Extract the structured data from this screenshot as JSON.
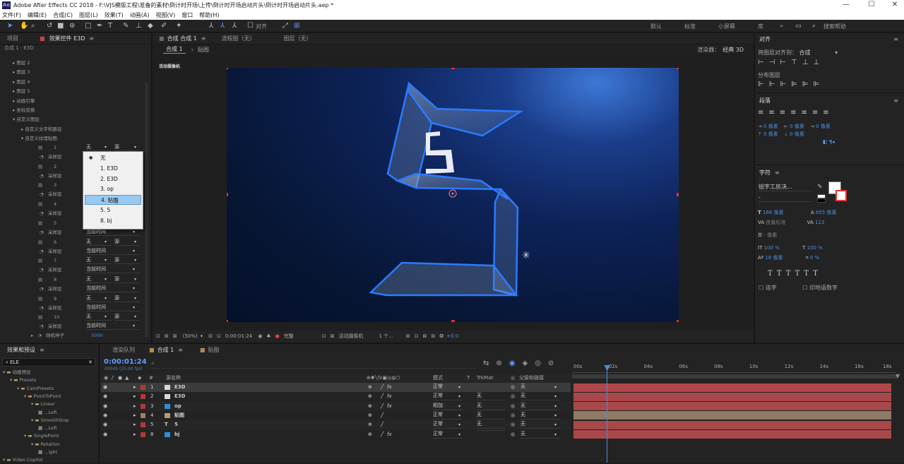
{
  "titlebar": {
    "logo": "Ae",
    "title": "Adobe After Effects CC 2018 - F:\\VJS模版工程\\准备的素材\\倒计时开场\\上传\\倒计时开场启动片头\\倒计时开场启动片头.aep *",
    "min": "—",
    "max": "☐",
    "close": "✕"
  },
  "menubar": [
    "文件(F)",
    "编辑(E)",
    "合成(C)",
    "图层(L)",
    "效果(T)",
    "动画(A)",
    "视图(V)",
    "窗口",
    "帮助(H)"
  ],
  "toolbar": {
    "align_label": "对齐",
    "workspaces": [
      "默认",
      "标准",
      "小屏幕",
      "库"
    ],
    "more": "»",
    "search_placeholder": "搜索帮助"
  },
  "left_panel": {
    "tab_project": "项目",
    "tab_effect_controls": "效果控件 E3D",
    "breadcrumb": "合成 1 · E3D",
    "tree": [
      {
        "label": "图层 2",
        "depth": 0
      },
      {
        "label": "图层 3",
        "depth": 0
      },
      {
        "label": "图层 4",
        "depth": 0
      },
      {
        "label": "图层 5",
        "depth": 0
      },
      {
        "label": "动画引擎",
        "depth": 0
      },
      {
        "label": "坐标变换",
        "depth": 0
      },
      {
        "label": "自定义图层",
        "depth": 0,
        "open": true
      },
      {
        "label": "自定义文字和路径",
        "depth": 1
      },
      {
        "label": "自定义纹理贴图",
        "depth": 1,
        "open": true
      }
    ],
    "texture_rows": [
      {
        "num": "1",
        "layer": "无",
        "src": "源",
        "sample_label": "采样层",
        "sample_value": ""
      },
      {
        "num": "2",
        "layer": "无",
        "src": "源",
        "sample_label": "采样层",
        "sample_value": ""
      },
      {
        "num": "3",
        "layer": "无",
        "src": "源",
        "sample_label": "采样层",
        "sample_value": ""
      },
      {
        "num": "4",
        "layer": "无",
        "src": "源",
        "sample_label": "采样层",
        "sample_value": ""
      },
      {
        "num": "5",
        "layer": "无",
        "src": "源",
        "sample_label": "采样层",
        "sample_value": "当前时间"
      },
      {
        "num": "6",
        "layer": "无",
        "src": "源",
        "sample_label": "采样层",
        "sample_value": "当前时间"
      },
      {
        "num": "7",
        "layer": "无",
        "src": "源",
        "sample_label": "采样层",
        "sample_value": "当前时间"
      },
      {
        "num": "8",
        "layer": "无",
        "src": "源",
        "sample_label": "采样层",
        "sample_value": "当前时间"
      },
      {
        "num": "9",
        "layer": "无",
        "src": "源",
        "sample_label": "采样层",
        "sample_value": "当前时间"
      },
      {
        "num": "10",
        "layer": "无",
        "src": "源",
        "sample_label": "采样层",
        "sample_value": "当前时间"
      }
    ],
    "random_seed_label": "随机种子",
    "random_seed_value": "5000",
    "dropdown": {
      "items": [
        "无",
        "1. E3D",
        "2. E3D",
        "3. op",
        "4. 贴图",
        "5. 5",
        "8. bj"
      ],
      "selected_index": 0,
      "hovered_index": 4
    }
  },
  "comp_panel": {
    "tab_comp": "合成 合成 1",
    "tab_flow": "流程图（无）",
    "tab_layer": "图层（无）",
    "sub_tabs": [
      "合成 1",
      "贴图"
    ],
    "renderer_label": "渲染器：",
    "renderer_value": "经典 3D",
    "camera_label": "活动摄像机",
    "viewer_digit": "5",
    "footer": {
      "zoom": "(50%)",
      "timecode": "0:00:01:24",
      "resolution": "完整",
      "camera": "活动摄像机",
      "views": "1 个...",
      "exposure": "+0.0"
    }
  },
  "right_panel": {
    "align": {
      "title": "对齐",
      "align_to_label": "将图层对齐到：",
      "align_to_value": "合成",
      "distribute_label": "分布图层"
    },
    "paragraph": {
      "title": "段落",
      "indent_values": [
        "0 像素",
        "0 像素",
        "0 像素",
        "0 像素",
        "0 像素"
      ]
    },
    "character": {
      "title": "字符",
      "font": "锐字工房决...",
      "font_style": "-",
      "size": "166 像素",
      "leading": "655 像素",
      "kerning": "度量标准",
      "tracking": "113",
      "stroke": "- 像素",
      "vscale": "100 %",
      "hscale": "100 %",
      "baseline": "18 像素",
      "tsume": "0 %",
      "ligatures_label": "连字",
      "hindi_label": "印地语数字"
    }
  },
  "effects_panel": {
    "title": "效果和预设",
    "search_value": "ELE",
    "tree": [
      {
        "label": "动画预设",
        "depth": 0
      },
      {
        "label": "Presets",
        "depth": 1
      },
      {
        "label": "CamPresets",
        "depth": 2
      },
      {
        "label": "PointToPoint",
        "depth": 3
      },
      {
        "label": "Linear",
        "depth": 4
      },
      {
        "label": "...Left",
        "depth": 5
      },
      {
        "label": "SmoothStop",
        "depth": 4
      },
      {
        "label": "...Left",
        "depth": 5
      },
      {
        "label": "SinglePoint",
        "depth": 3
      },
      {
        "label": "Rotation",
        "depth": 4
      },
      {
        "label": "...ight",
        "depth": 5
      },
      {
        "label": "Video Copilot",
        "depth": 0
      }
    ]
  },
  "timeline": {
    "tab_render": "渲染队列",
    "tab_comp": "合成 1",
    "tab_texture": "贴图",
    "timecode": "0:00:01:24",
    "frame_info": "00049 (25.00 fps)",
    "columns": {
      "num": "#",
      "name": "源名称",
      "mode": "模式",
      "t": "T",
      "trkmat": "TrkMat",
      "parent": "父级和链接"
    },
    "ruler": [
      "00s",
      "02s",
      "04s",
      "06s",
      "08s",
      "10s",
      "12s",
      "14s",
      "16s",
      "18s"
    ],
    "playhead_fraction": 0.105,
    "layers": [
      {
        "num": "1",
        "name": "E3D",
        "color": "#d8d8d8",
        "label": "#b2373a",
        "mode": "正常",
        "trkmat": "",
        "parent": "无",
        "bar": "#b0474a",
        "selected": true,
        "fx": true
      },
      {
        "num": "2",
        "name": "E3D",
        "color": "#d8d8d8",
        "label": "#b2373a",
        "mode": "正常",
        "trkmat": "无",
        "parent": "无",
        "bar": "#a8484a",
        "selected": false,
        "fx": true
      },
      {
        "num": "3",
        "name": "op",
        "color": "#2f8fd8",
        "label": "#b2373a",
        "mode": "相加",
        "trkmat": "无",
        "parent": "无",
        "bar": "#a8484a",
        "selected": false,
        "fx": true
      },
      {
        "num": "4",
        "name": "贴图",
        "color": "#b59a7a",
        "label": "#9b8266",
        "mode": "正常",
        "trkmat": "无",
        "parent": "无",
        "bar": "#8f7a64",
        "selected": false,
        "fx": false
      },
      {
        "num": "5",
        "name": "5",
        "color": "",
        "label": "#b2373a",
        "mode": "正常",
        "trkmat": "无",
        "parent": "无",
        "bar": "#a8484a",
        "selected": false,
        "fx": false
      },
      {
        "num": "8",
        "name": "bj",
        "color": "#2f8fd8",
        "label": "#b2373a",
        "mode": "正常",
        "trkmat": "",
        "parent": "无",
        "bar": "#a8484a",
        "selected": false,
        "fx": true
      }
    ]
  }
}
